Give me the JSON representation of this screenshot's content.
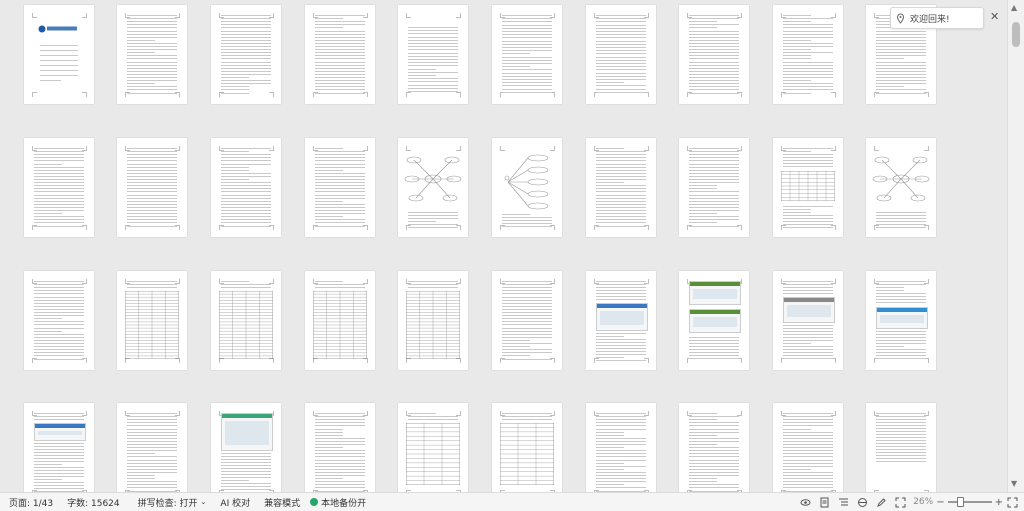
{
  "statusbar": {
    "page": "页面: 1/43",
    "words": "字数: 15624",
    "spellcheck": "拼写检查: 打开",
    "ai_proofread": "AI 校对",
    "compat_mode": "兼容模式",
    "local_backup": "本地备份开",
    "zoom": "26%",
    "zoom_level": 0.26,
    "zoom_minus": "−",
    "zoom_plus": "+"
  },
  "floating_button": {
    "label": "欢迎回来!",
    "icon": "location-pin-icon",
    "close": "✕"
  },
  "scrollbar": {
    "up": "▲",
    "down": "▼"
  },
  "colors": {
    "statusbar_bg": "#f5f5f6",
    "canvas_bg": "#e9e9ea",
    "accent_green": "#21a86a",
    "cover_blue": "#1e5aa8"
  },
  "pages": {
    "cover": {
      "title": "本科毕业设计（论文）报告",
      "school": "常州工学院"
    },
    "toc_title": "目 录",
    "abstract_title": "基于Java的物品信息管理系统",
    "english_abstract_title": "Online Questionnaire Survey System Based on Web"
  }
}
